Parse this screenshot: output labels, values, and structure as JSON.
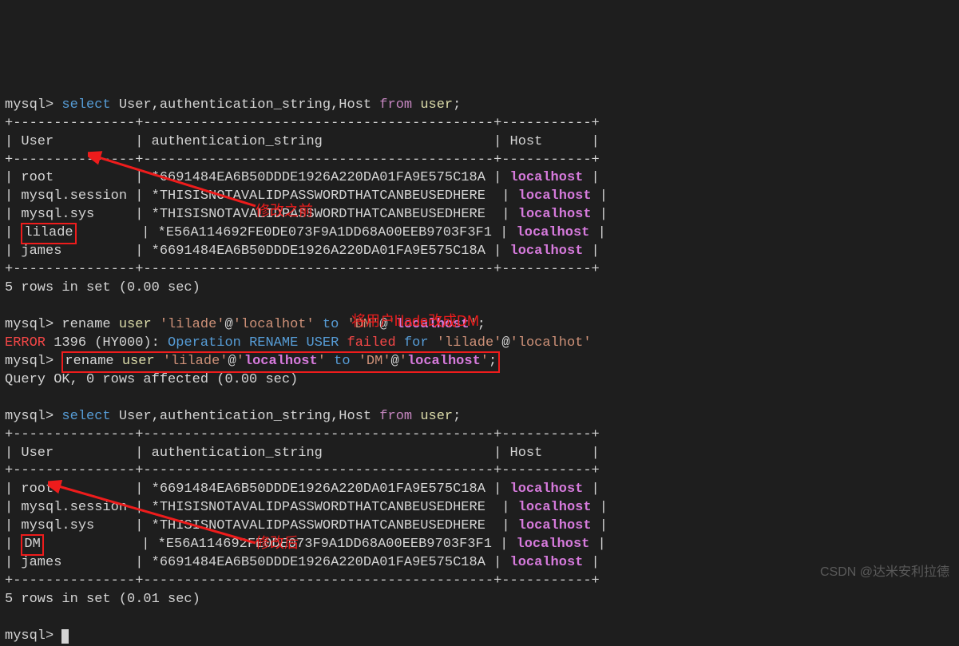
{
  "prompt": "mysql>",
  "queries": {
    "select1": "select User,authentication_string,Host from user;",
    "renameBad": "rename user 'lilade'@'localhot' to 'DM'@'localhost';",
    "renameGood": "rename user 'lilade'@'localhost' to 'DM'@'localhost';",
    "select2": "select User,authentication_string,Host from user;"
  },
  "table1": {
    "border": "+---------------+-------------------------------------------+-----------+",
    "headers": {
      "user": "User",
      "auth": "authentication_string",
      "host": "Host"
    },
    "rows": [
      {
        "user": "root",
        "auth": "*6691484EA6B50DDDE1926A220DA01FA9E575C18A",
        "host": "localhost"
      },
      {
        "user": "mysql.session",
        "auth": "*THISISNOTAVALIDPASSWORDTHATCANBEUSEDHERE",
        "host": "localhost"
      },
      {
        "user": "mysql.sys",
        "auth": "*THISISNOTAVALIDPASSWORDTHATCANBEUSEDHERE",
        "host": "localhost"
      },
      {
        "user": "lilade",
        "auth": "*E56A114692FE0DE073F9A1DD68A00EEB9703F3F1",
        "host": "localhost"
      },
      {
        "user": "james",
        "auth": "*6691484EA6B50DDDE1926A220DA01FA9E575C18A",
        "host": "localhost"
      }
    ],
    "footer": "5 rows in set (0.00 sec)"
  },
  "error": {
    "prefix": "ERROR",
    "code": "1396 (HY000):",
    "operation": "Operation",
    "what": "RENAME USER",
    "failed": "failed",
    "for_": "for",
    "target": "'lilade'@'localhot'"
  },
  "renameResult": "Query OK, 0 rows affected (0.00 sec)",
  "table2": {
    "border": "+---------------+-------------------------------------------+-----------+",
    "headers": {
      "user": "User",
      "auth": "authentication_string",
      "host": "Host"
    },
    "rows": [
      {
        "user": "root",
        "auth": "*6691484EA6B50DDDE1926A220DA01FA9E575C18A",
        "host": "localhost"
      },
      {
        "user": "mysql.session",
        "auth": "*THISISNOTAVALIDPASSWORDTHATCANBEUSEDHERE",
        "host": "localhost"
      },
      {
        "user": "mysql.sys",
        "auth": "*THISISNOTAVALIDPASSWORDTHATCANBEUSEDHERE",
        "host": "localhost"
      },
      {
        "user": "DM",
        "auth": "*E56A114692FE0DE073F9A1DD68A00EEB9703F3F1",
        "host": "localhost"
      },
      {
        "user": "james",
        "auth": "*6691484EA6B50DDDE1926A220DA01FA9E575C18A",
        "host": "localhost"
      }
    ],
    "footer": "5 rows in set (0.01 sec)"
  },
  "annotations": {
    "before": "修改之前",
    "rename": "将用户lilade改成DM",
    "after": "修改后"
  },
  "watermark": "CSDN @达米安利拉德"
}
